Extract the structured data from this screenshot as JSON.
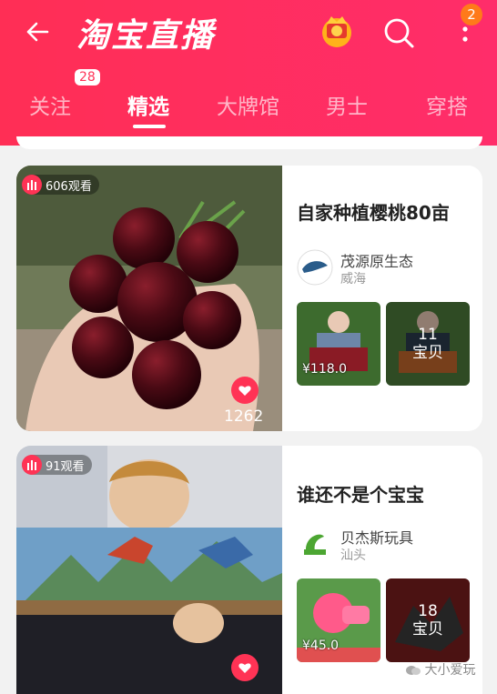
{
  "header": {
    "title": "淘宝直播",
    "notification_count": "2",
    "tabs": [
      {
        "label": "关注",
        "badge": "28"
      },
      {
        "label": "精选"
      },
      {
        "label": "大牌馆"
      },
      {
        "label": "男士"
      },
      {
        "label": "穿搭"
      }
    ]
  },
  "streams": [
    {
      "viewers": "606观看",
      "title": "自家种植樱桃80亩",
      "seller_name": "茂源原生态",
      "seller_location": "威海",
      "likes": "1262",
      "products": [
        {
          "price": "¥118.0"
        },
        {
          "count": "11",
          "count_label": "宝贝"
        }
      ]
    },
    {
      "viewers": "91观看",
      "title": "谁还不是个宝宝",
      "seller_name": "贝杰斯玩具",
      "seller_location": "汕头",
      "products": [
        {
          "price": "¥45.0"
        },
        {
          "count": "18",
          "count_label": "宝贝"
        }
      ]
    }
  ],
  "watermark": "大小爱玩",
  "colors": {
    "brand": "#ff2d55",
    "like": "#ff3355"
  }
}
